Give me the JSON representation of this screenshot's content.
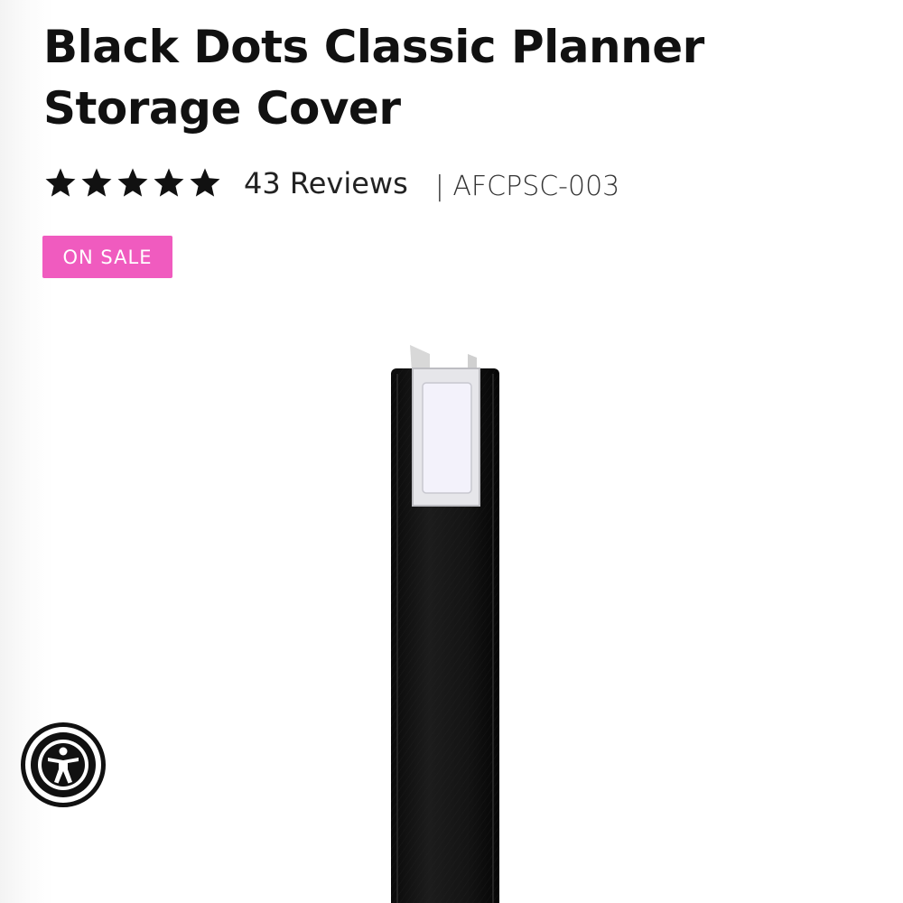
{
  "product": {
    "title": "Black Dots Classic Planner Storage Cover",
    "rating": {
      "stars": 5,
      "max_stars": 5,
      "reviews_label": "43 Reviews"
    },
    "sku_label": "| AFCPSC-003",
    "badge_label": "ON SALE",
    "image_alt": "Black Dots Classic Planner Storage Cover"
  },
  "colors": {
    "badge": "#f05bbf",
    "text": "#111111",
    "star": "#111111",
    "product_cover": "#151515"
  },
  "icons": {
    "star": "star-icon",
    "accessibility": "accessibility-icon"
  }
}
